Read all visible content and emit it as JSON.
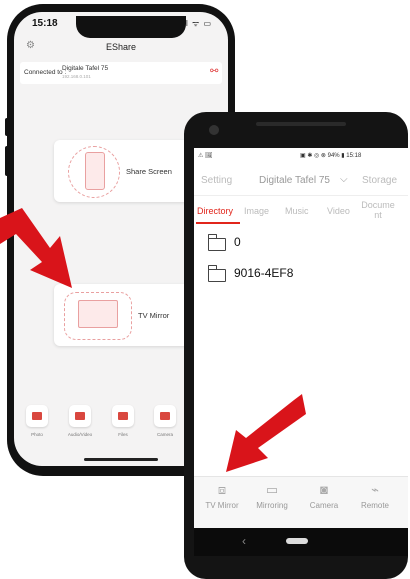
{
  "iphone": {
    "status_time": "15:18",
    "status_icons": "•ıl ᯤ ▭",
    "app_title": "EShare",
    "connected_label": "Connected to :",
    "connected_device": "Digitale Tafel 75",
    "connected_sub": "192.168.0.101",
    "cards": [
      {
        "label": "Share Screen"
      },
      {
        "label": "TV Mirror"
      }
    ],
    "bottom_tiles": [
      {
        "label": "Photo"
      },
      {
        "label": "Audio/Video"
      },
      {
        "label": "Files"
      },
      {
        "label": "Camera"
      }
    ]
  },
  "android": {
    "status_left": "⚠ 🖼",
    "status_right": "▣ ✱ ◎ ⊗ 94% ▮ 15:18",
    "nav": {
      "setting": "Setting",
      "device": "Digitale Tafel 75",
      "storage": "Storage"
    },
    "tabs": [
      "Directory",
      "Image",
      "Music",
      "Video",
      "Document"
    ],
    "files": [
      {
        "name": "0"
      },
      {
        "name": "9016-4EF8"
      }
    ],
    "bottom_items": [
      {
        "label": "TV Mirror",
        "icon": "tv-icon"
      },
      {
        "label": "Mirroring",
        "icon": "mirroring-icon"
      },
      {
        "label": "Camera",
        "icon": "camera-icon"
      },
      {
        "label": "Remote",
        "icon": "remote-icon"
      }
    ]
  },
  "colors": {
    "accent": "#e1251b",
    "arrow": "#d9141a"
  }
}
